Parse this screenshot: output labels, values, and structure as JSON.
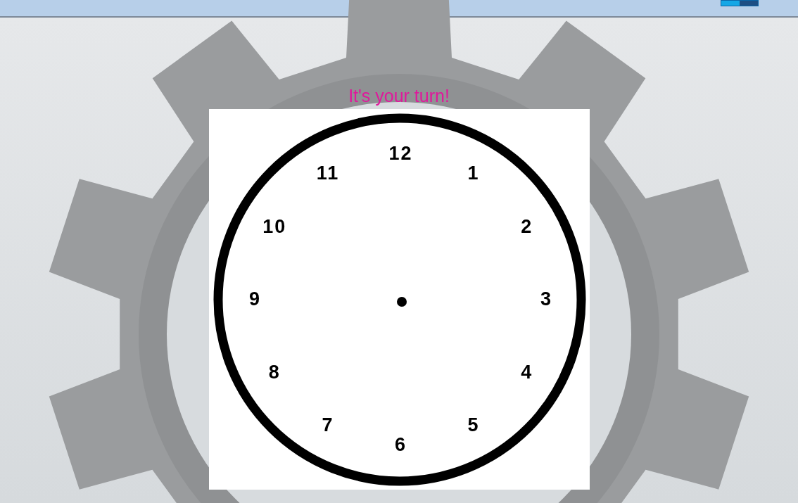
{
  "top_bar": {
    "progress": {
      "level": 0.5
    }
  },
  "prompt": "It's your turn!",
  "clock": {
    "numbers": [
      "12",
      "1",
      "2",
      "3",
      "4",
      "5",
      "6",
      "7",
      "8",
      "9",
      "10",
      "11"
    ]
  }
}
